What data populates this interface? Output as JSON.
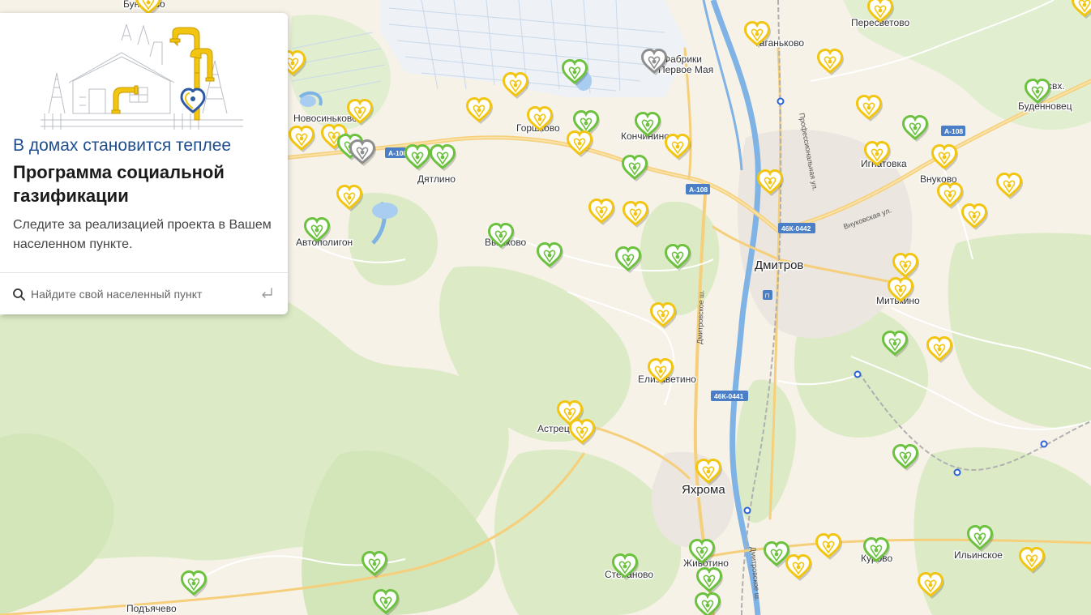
{
  "panel": {
    "subtitle": "В домах становится теплее",
    "title": "Программа социальной газификации",
    "description": "Следите за реализацией проекта в Вашем населенном пункте.",
    "search": {
      "placeholder": "Найдите свой населенный пункт"
    }
  },
  "map": {
    "places": [
      {
        "name": "Бунятово",
        "big": false
      },
      {
        "name": "Новосиньково",
        "big": false
      },
      {
        "name": "Дятлино",
        "big": false
      },
      {
        "name": "Горшково",
        "big": false
      },
      {
        "name": "Кончинино",
        "big": false
      },
      {
        "name": "Фабрики",
        "big": false
      },
      {
        "name": "Первое Мая",
        "big": false
      },
      {
        "name": "Таганьково",
        "big": false
      },
      {
        "name": "Пересветово",
        "big": false
      },
      {
        "name": "свх.",
        "big": false
      },
      {
        "name": "Буденновец",
        "big": false
      },
      {
        "name": "Игнатовка",
        "big": false
      },
      {
        "name": "Внуково",
        "big": false
      },
      {
        "name": "Автополигон",
        "big": false
      },
      {
        "name": "Вышково",
        "big": false
      },
      {
        "name": "Дмитров",
        "big": true
      },
      {
        "name": "Митькино",
        "big": false
      },
      {
        "name": "Елизаветино",
        "big": false
      },
      {
        "name": "Астрецово",
        "big": false
      },
      {
        "name": "Яхрома",
        "big": true
      },
      {
        "name": "Ильинское",
        "big": false
      },
      {
        "name": "Курово",
        "big": false
      },
      {
        "name": "Животино",
        "big": false
      },
      {
        "name": "Степаново",
        "big": false
      },
      {
        "name": "Подъячево",
        "big": false
      }
    ],
    "shields": [
      "А-108",
      "А-108",
      "А-108",
      "А-108",
      "46К-0442",
      "46К-0441"
    ],
    "streets": [
      "Профессиональная ул.",
      "Внуковская ул.",
      "Дмитровское ш.",
      "Дмитровское ш."
    ],
    "marker_colors": {
      "yellow": "#f2c511",
      "green": "#6cc13f",
      "gray": "#8e8e8e"
    },
    "markers": [
      {
        "status": "yellow"
      },
      {
        "status": "yellow"
      },
      {
        "status": "yellow"
      },
      {
        "status": "yellow"
      },
      {
        "status": "yellow"
      },
      {
        "status": "green"
      },
      {
        "status": "gray"
      },
      {
        "status": "yellow"
      },
      {
        "status": "green"
      },
      {
        "status": "green"
      },
      {
        "status": "yellow"
      },
      {
        "status": "yellow"
      },
      {
        "status": "yellow"
      },
      {
        "status": "green"
      },
      {
        "status": "gray"
      },
      {
        "status": "green"
      },
      {
        "status": "green"
      },
      {
        "status": "yellow"
      },
      {
        "status": "yellow"
      },
      {
        "status": "green"
      },
      {
        "status": "yellow"
      },
      {
        "status": "green"
      },
      {
        "status": "yellow"
      },
      {
        "status": "yellow"
      },
      {
        "status": "yellow"
      },
      {
        "status": "yellow"
      },
      {
        "status": "yellow"
      },
      {
        "status": "green"
      },
      {
        "status": "yellow"
      },
      {
        "status": "yellow"
      },
      {
        "status": "yellow"
      },
      {
        "status": "green"
      },
      {
        "status": "yellow"
      },
      {
        "status": "green"
      },
      {
        "status": "green"
      },
      {
        "status": "green"
      },
      {
        "status": "yellow"
      },
      {
        "status": "yellow"
      },
      {
        "status": "yellow"
      },
      {
        "status": "yellow"
      },
      {
        "status": "green"
      },
      {
        "status": "yellow"
      },
      {
        "status": "yellow"
      },
      {
        "status": "yellow"
      },
      {
        "status": "green"
      },
      {
        "status": "yellow"
      },
      {
        "status": "yellow"
      },
      {
        "status": "green"
      },
      {
        "status": "green"
      },
      {
        "status": "green"
      },
      {
        "status": "green"
      },
      {
        "status": "green"
      },
      {
        "status": "green"
      },
      {
        "status": "green"
      },
      {
        "status": "yellow"
      },
      {
        "status": "yellow"
      },
      {
        "status": "green"
      },
      {
        "status": "yellow"
      },
      {
        "status": "green"
      },
      {
        "status": "green"
      },
      {
        "status": "yellow"
      },
      {
        "status": "yellow"
      },
      {
        "status": "green"
      },
      {
        "status": "yellow"
      }
    ]
  }
}
